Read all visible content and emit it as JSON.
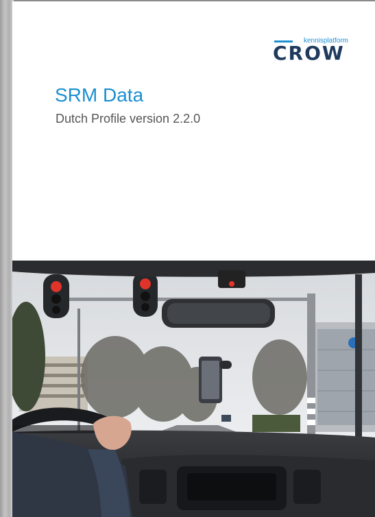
{
  "logo": {
    "top_text": "kennisplatform",
    "main_text": "CROW"
  },
  "cover": {
    "title": "SRM Data",
    "subtitle": "Dutch Profile version 2.2.0"
  },
  "photo": {
    "description_icon": "dashboard-traffic-light-photo-icon"
  },
  "colors": {
    "title": "#1a8fd1",
    "logo_accent": "#1d8fd2",
    "logo_main": "#1e3a5c"
  }
}
